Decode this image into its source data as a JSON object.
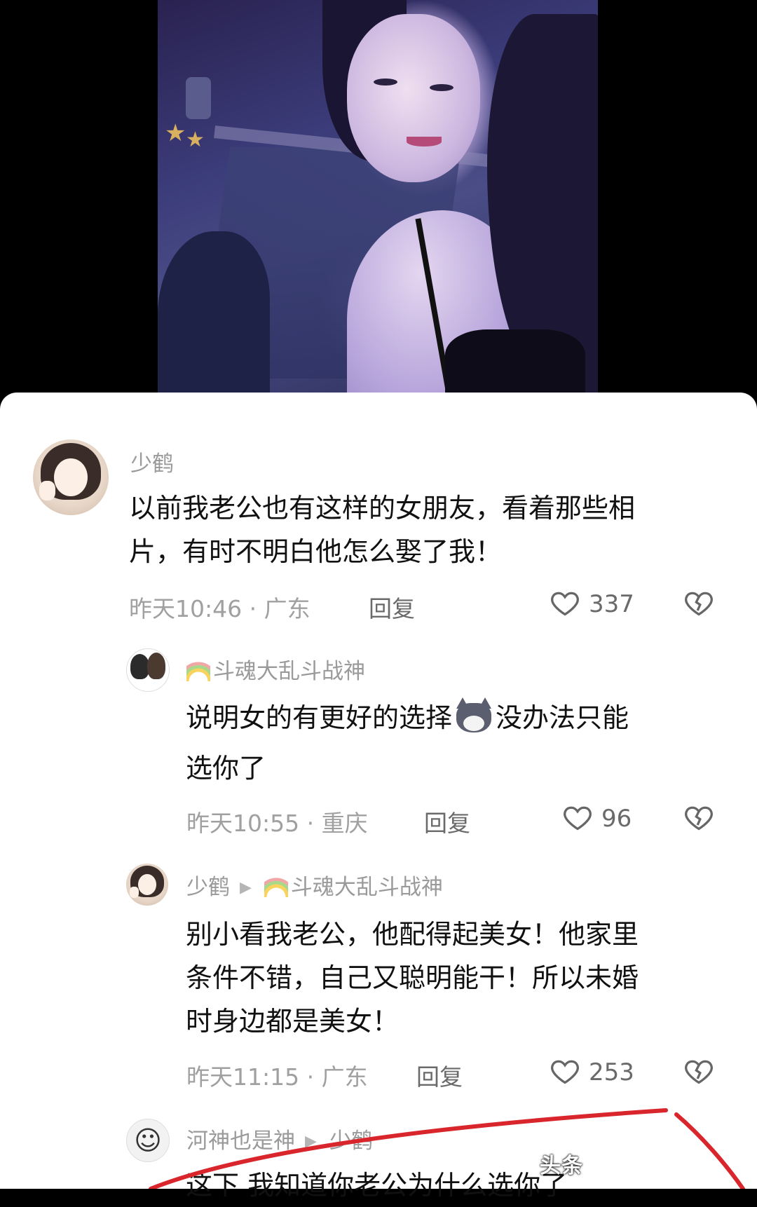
{
  "comments": [
    {
      "username": "少鹤",
      "text_line1": "以前我老公也有这样的女朋友，看着那些相",
      "text_line2": "片，有时不明白他怎么娶了我！",
      "meta": "昨天10:46 · 广东",
      "reply_label": "回复",
      "likes": "337"
    },
    {
      "username": "斗魂大乱斗战神",
      "text_line1a": "说明女的有更好的选择",
      "text_line1b": "没办法只能",
      "text_line2": "选你了",
      "meta": "昨天10:55 · 重庆",
      "reply_label": "回复",
      "likes": "96"
    },
    {
      "username": "少鹤",
      "reply_to": "斗魂大乱斗战神",
      "text_line1": "别小看我老公，他配得起美女！他家里",
      "text_line2": "条件不错，自己又聪明能干！所以未婚",
      "text_line3": "时身边都是美女！",
      "meta": "昨天11:15 · 广东",
      "reply_label": "回复",
      "likes": "253"
    },
    {
      "username": "河神也是神",
      "reply_to": "少鹤",
      "text_line1": "这下 我知道你老公为什么选你了"
    }
  ],
  "watermark": "头条",
  "colors": {
    "accent_red": "#d9262c",
    "meta_gray": "#a0a0a0",
    "text": "#111111"
  },
  "icons": [
    "heart-outline-icon",
    "broken-heart-icon",
    "rainbow-badge-icon",
    "reply-arrow-icon"
  ]
}
